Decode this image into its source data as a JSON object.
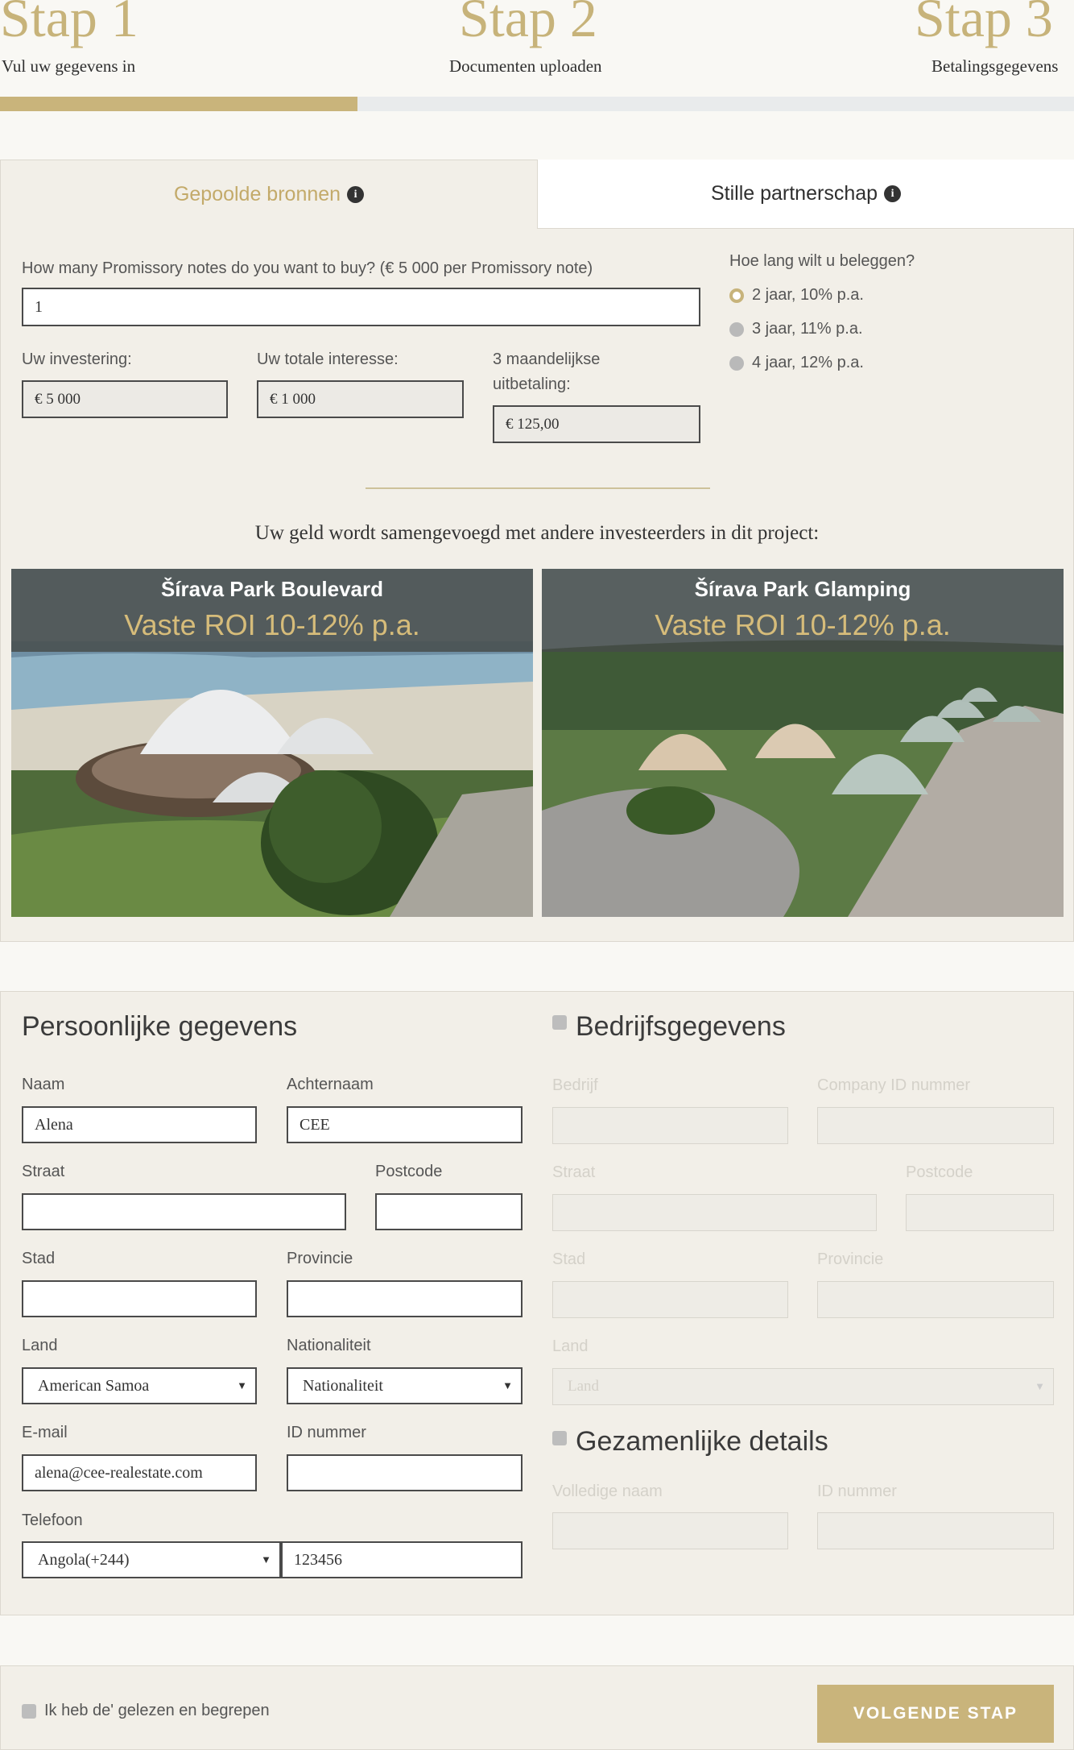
{
  "steps": [
    {
      "title": "Stap 1",
      "subtitle": "Vul uw gegevens in"
    },
    {
      "title": "Stap 2",
      "subtitle": "Documenten uploaden"
    },
    {
      "title": "Stap 3",
      "subtitle": "Betalingsgegevens"
    }
  ],
  "progress": {
    "fraction": 0.333
  },
  "tabs": {
    "pooled": "Gepoolde bronnen",
    "silent": "Stille partnerschap"
  },
  "investment": {
    "notes_label": "How many Promissory notes do you want to buy? (€ 5 000 per Promissory note)",
    "notes_value": "1",
    "investment_label": "Uw investering:",
    "investment_value": "€ 5 000",
    "interest_label": "Uw totale interesse:",
    "interest_value": "€ 1 000",
    "payout_label_1": "3 maandelijkse",
    "payout_label_2": "uitbetaling:",
    "payout_value": "€ 125,00",
    "duration_label": "Hoe lang wilt u beleggen?",
    "options": [
      "2 jaar, 10% p.a.",
      "3 jaar, 11% p.a.",
      "4 jaar, 12% p.a."
    ],
    "selected_option": 0
  },
  "pool_text": "Uw geld wordt samengevoegd met andere investeerders in dit project:",
  "projects": [
    {
      "name": "Šírava Park Boulevard",
      "roi": "Vaste ROI 10-12% p.a."
    },
    {
      "name": "Šírava Park Glamping",
      "roi": "Vaste ROI 10-12% p.a."
    }
  ],
  "personal": {
    "title": "Persoonlijke gegevens",
    "first_name_label": "Naam",
    "first_name": "Alena",
    "last_name_label": "Achternaam",
    "last_name": "CEE",
    "street_label": "Straat",
    "street": "",
    "postcode_label": "Postcode",
    "postcode": "",
    "city_label": "Stad",
    "city": "",
    "province_label": "Provincie",
    "province": "",
    "country_label": "Land",
    "country": "American Samoa",
    "nationality_label": "Nationaliteit",
    "nationality": "Nationaliteit",
    "email_label": "E-mail",
    "email": "alena@cee-realestate.com",
    "id_label": "ID nummer",
    "id": "",
    "phone_label": "Telefoon",
    "phone_code": "Angola(+244)",
    "phone": "123456"
  },
  "company": {
    "title": "Bedrijfsgegevens",
    "company_label": "Bedrijf",
    "company_id_label": "Company ID nummer",
    "street_label": "Straat",
    "postcode_label": "Postcode",
    "city_label": "Stad",
    "province_label": "Provincie",
    "country_label": "Land",
    "country_placeholder": "Land"
  },
  "joint": {
    "title": "Gezamenlijke details",
    "full_name_label": "Volledige naam",
    "id_label": "ID nummer"
  },
  "footer": {
    "agree_text": "Ik heb de' gelezen en begrepen",
    "next_button": "VOLGENDE STAP"
  },
  "colors": {
    "accent": "#c9b47b",
    "panel": "#f2efe8",
    "page": "#f9f8f4"
  }
}
